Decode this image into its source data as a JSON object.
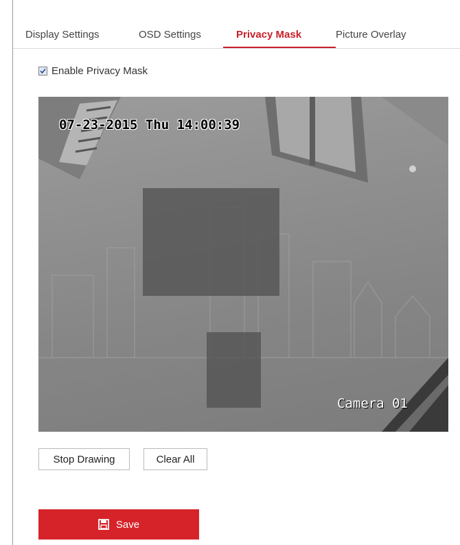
{
  "tabs": [
    {
      "label": "Display Settings",
      "active": false
    },
    {
      "label": "OSD Settings",
      "active": false
    },
    {
      "label": "Privacy Mask",
      "active": true
    },
    {
      "label": "Picture Overlay",
      "active": false
    }
  ],
  "enable_privacy_mask": {
    "label": "Enable Privacy Mask",
    "checked": true
  },
  "video": {
    "osd_datetime": "07-23-2015 Thu 14:00:39",
    "camera_name": "Camera 01",
    "mask_count": 2
  },
  "buttons": {
    "stop_drawing": "Stop Drawing",
    "clear_all": "Clear All",
    "save": "Save"
  },
  "colors": {
    "accent": "#c8202a",
    "save_button": "#d52329",
    "mask": "#525252"
  },
  "icons": {
    "save": "floppy-disk-icon",
    "checkbox": "checkmark-icon"
  }
}
